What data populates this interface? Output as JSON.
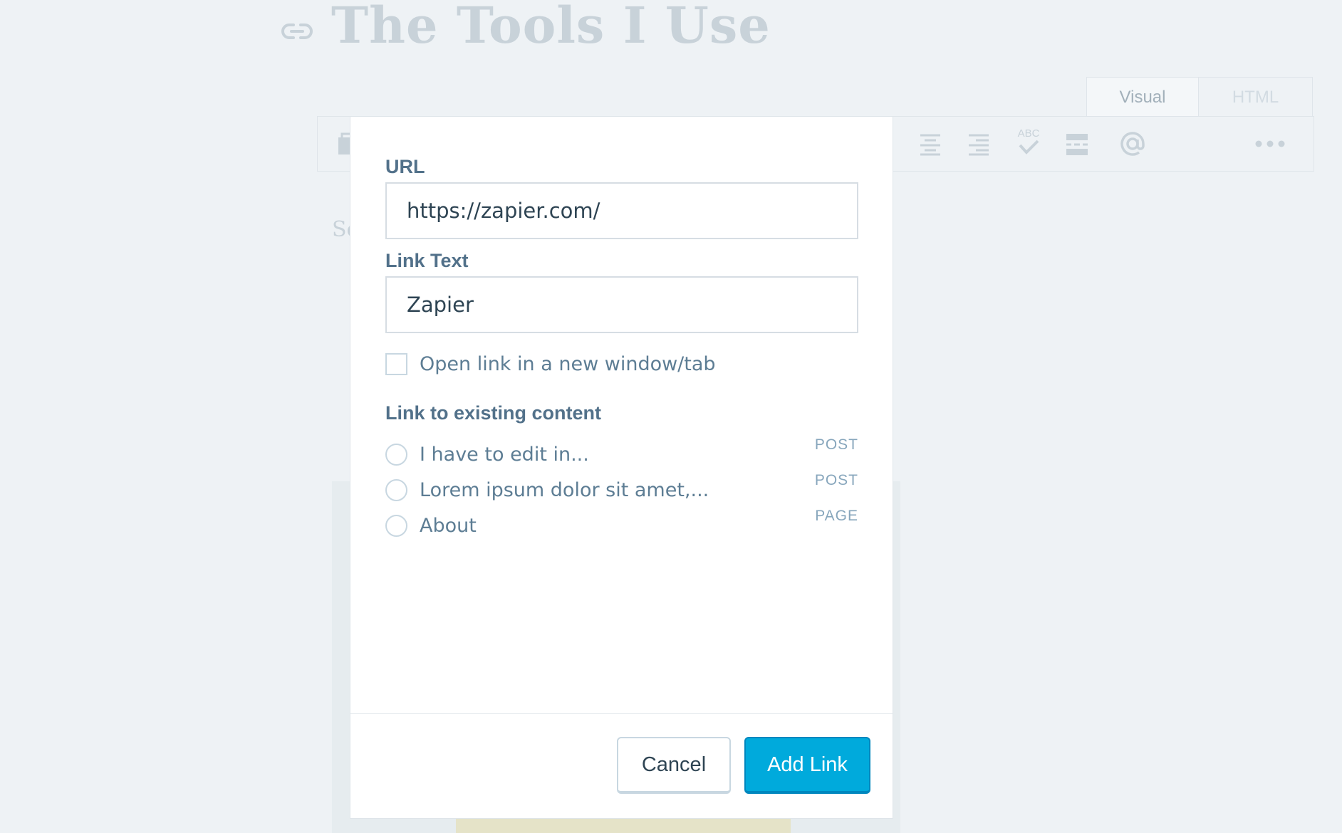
{
  "editor": {
    "post_title": "The Tools I Use",
    "body_placeholder": "So",
    "tabs": [
      {
        "label": "Visual",
        "active": true
      },
      {
        "label": "HTML",
        "active": false
      }
    ],
    "toolbar_icons": [
      "add-media-icon",
      "align-center-icon",
      "align-right-icon",
      "spellcheck-icon",
      "read-more-icon",
      "contact-form-icon",
      "more-icon"
    ],
    "spellcheck_glyph": "ABC"
  },
  "link_dialog": {
    "url_label": "URL",
    "url_value": "https://zapier.com/",
    "link_text_label": "Link Text",
    "link_text_value": "Zapier",
    "new_window_label": "Open link in a new window/tab",
    "new_window_checked": false,
    "existing_content_heading": "Link to existing content",
    "existing_content": [
      {
        "title": "I have to edit in...",
        "type": "POST"
      },
      {
        "title": "Lorem ipsum dolor sit amet,...",
        "type": "POST"
      },
      {
        "title": "About",
        "type": "PAGE"
      }
    ],
    "cancel_label": "Cancel",
    "add_link_label": "Add Link"
  },
  "colors": {
    "primary_button": "#00aadc",
    "label_text": "#52718a",
    "background": "#eef2f5"
  }
}
